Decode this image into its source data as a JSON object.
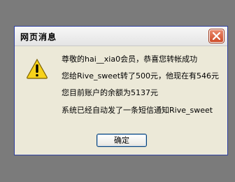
{
  "dialog": {
    "title": "网页消息",
    "close_icon": "close-icon",
    "warning_icon": "warning-icon",
    "lines": [
      "尊敬的hai__xia0会员，恭喜您转帐成功",
      "您给Rive_sweet转了500元，他现在有546元",
      "您目前账户的余额为5137元",
      "系统已经自动发了一条短信通知Rive_sweet"
    ],
    "ok_label": "确定"
  }
}
